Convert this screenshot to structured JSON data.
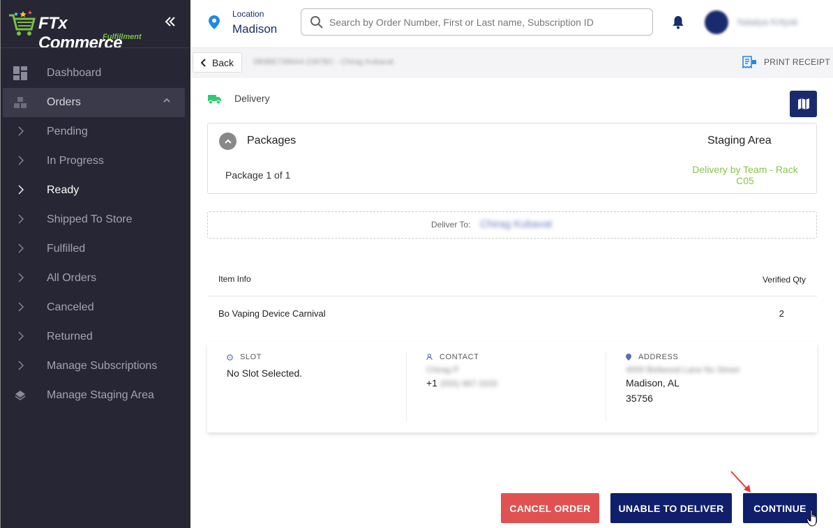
{
  "brand": {
    "name": "FTx Commerce",
    "sub": "Fulfillment"
  },
  "sidebar": {
    "items": [
      {
        "label": "Dashboard",
        "icon": "dashboard-icon"
      },
      {
        "label": "Orders",
        "icon": "orders-icon"
      },
      {
        "label": "Pending"
      },
      {
        "label": "In Progress"
      },
      {
        "label": "Ready"
      },
      {
        "label": "Shipped To Store"
      },
      {
        "label": "Fulfilled"
      },
      {
        "label": "All Orders"
      },
      {
        "label": "Canceled"
      },
      {
        "label": "Returned"
      },
      {
        "label": "Manage Subscriptions"
      },
      {
        "label": "Manage Staging Area",
        "icon": "layers-icon"
      }
    ]
  },
  "header": {
    "location_label": "Location",
    "location_value": "Madison",
    "search_placeholder": "Search by Order Number, First or Last name, Subscription ID",
    "user_name": "Natalya Kritysk"
  },
  "subheader": {
    "back_label": "Back",
    "order_ref": "0B9BE7386A4-2387BC - Chirag Kubavat",
    "print_label": "PRINT RECEIPT"
  },
  "delivery": {
    "label": "Delivery",
    "packages_title": "Packages",
    "staging_title": "Staging Area",
    "package_count": "Package 1 of 1",
    "staging_value": "Delivery by Team - Rack C05",
    "deliver_to_label": "Deliver To:",
    "deliver_to_name": "Chirag Kubavat"
  },
  "items": {
    "col_info": "Item Info",
    "col_qty": "Verified Qty",
    "rows": [
      {
        "name": "Bo Vaping Device Carnival",
        "qty": "2"
      }
    ]
  },
  "info": {
    "slot_head": "SLOT",
    "slot_value": "No Slot Selected.",
    "contact_head": "CONTACT",
    "contact_name": "Chirag P",
    "contact_phone_prefix": "+1",
    "contact_phone": "(555) 987-3333",
    "address_head": "ADDRESS",
    "address_line1": "4000 Bellwood Lane No Street",
    "address_line2": "Madison, AL",
    "address_line3": "35756"
  },
  "actions": {
    "cancel": "CANCEL ORDER",
    "unable": "UNABLE TO DELIVER",
    "continue": "CONTINUE"
  },
  "colors": {
    "sidebar_bg": "#262634",
    "primary": "#0f1f6b",
    "danger": "#e05252",
    "accent_green": "#8bc34a",
    "pin_blue": "#1e88e5"
  }
}
